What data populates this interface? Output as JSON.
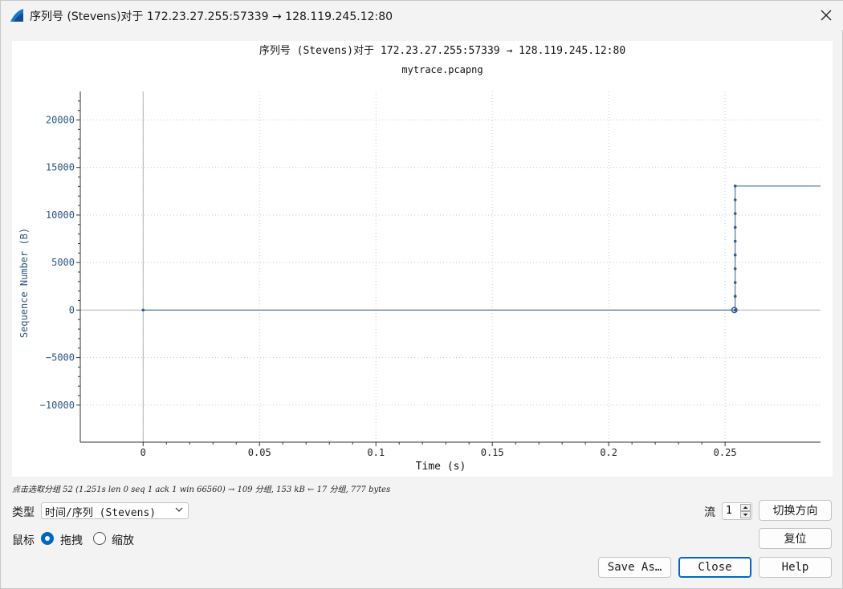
{
  "window": {
    "title": "序列号 (Stevens)对于 172.23.27.255:57339 → 128.119.245.12:80"
  },
  "chart_data": {
    "type": "scatter",
    "title": "序列号 (Stevens)对于 172.23.27.255:57339 → 128.119.245.12:80",
    "subtitle": "mytrace.pcapng",
    "xlabel": "Time (s)",
    "ylabel": "Sequence Number (B)",
    "xlim": [
      -0.027,
      0.291
    ],
    "ylim": [
      -13900,
      23000
    ],
    "x_ticks": [
      0,
      0.05,
      0.1,
      0.15,
      0.2,
      0.25
    ],
    "x_tick_labels": [
      "0",
      "0.05",
      "0.1",
      "0.15",
      "0.2",
      "0.25"
    ],
    "y_ticks": [
      -10000,
      -5000,
      0,
      5000,
      10000,
      15000,
      20000
    ],
    "y_tick_labels": [
      "−10000",
      "−5000",
      "0",
      "5000",
      "10000",
      "15000",
      "20000"
    ],
    "grid": true,
    "series": [
      {
        "x": [
          0,
          0.254,
          0.254,
          0.254,
          0.254,
          0.254,
          0.254,
          0.254,
          0.254,
          0.254,
          0.254
        ],
        "y": [
          0,
          1,
          1450,
          2900,
          4350,
          5800,
          7250,
          8700,
          10150,
          11600,
          13050
        ]
      }
    ],
    "selected_point": {
      "x": 0.254,
      "y": 0
    },
    "window_line": {
      "x_start": 0,
      "x_end": 0.254,
      "y": 0
    },
    "ack_line": {
      "x_start": 0.254,
      "x_end": 0.291,
      "y": 13050
    }
  },
  "status_hint": "点击选取分组 52 (1.251s len 0 seq 1 ack 1 win 66560) → 109 分组, 153 kB ← 17 分组, 777 bytes",
  "controls": {
    "type_label": "类型",
    "type_value": "时间/序列 (Stevens)",
    "stream_label": "流",
    "stream_value": "1",
    "switch_direction": "切换方向",
    "mouse_label": "鼠标",
    "drag_label": "拖拽",
    "zoom_label": "缩放",
    "reset": "复位",
    "save_as": "Save As…",
    "close": "Close",
    "help": "Help"
  },
  "colors": {
    "series": "#2f5a9a",
    "axis_text": "#2c5584",
    "accent": "#0067c0"
  }
}
